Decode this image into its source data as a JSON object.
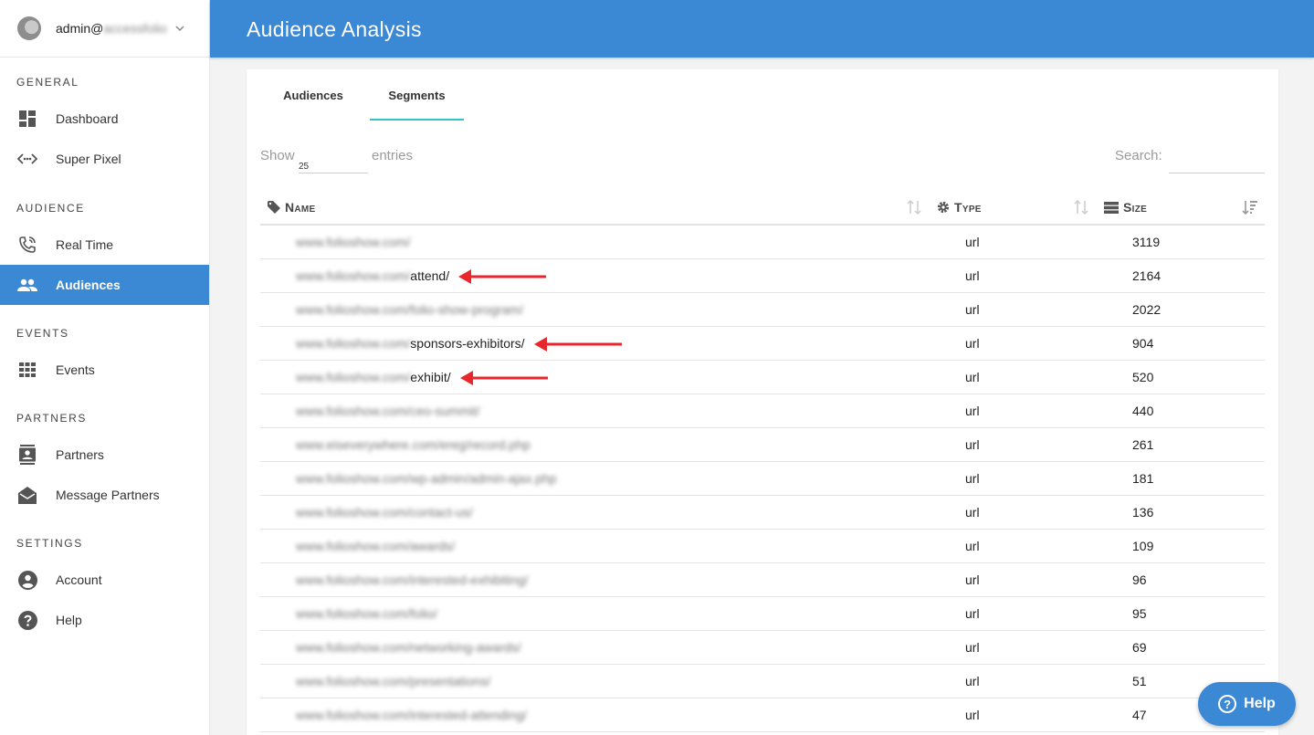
{
  "user": {
    "name_prefix": "admin@",
    "name_blurred": "accessfolio"
  },
  "sidebar": {
    "sections": [
      {
        "title": "GENERAL",
        "items": [
          {
            "label": "Dashboard",
            "icon": "dashboard-icon"
          },
          {
            "label": "Super Pixel",
            "icon": "code-dots-icon"
          }
        ]
      },
      {
        "title": "AUDIENCE",
        "items": [
          {
            "label": "Real Time",
            "icon": "phone-icon"
          },
          {
            "label": "Audiences",
            "icon": "people-icon",
            "active": true
          }
        ]
      },
      {
        "title": "EVENTS",
        "items": [
          {
            "label": "Events",
            "icon": "grid-icon"
          }
        ]
      },
      {
        "title": "PARTNERS",
        "items": [
          {
            "label": "Partners",
            "icon": "contacts-icon"
          },
          {
            "label": "Message Partners",
            "icon": "drafts-icon"
          }
        ]
      },
      {
        "title": "SETTINGS",
        "items": [
          {
            "label": "Account",
            "icon": "account-circle-icon"
          },
          {
            "label": "Help",
            "icon": "help-circle-icon"
          }
        ]
      }
    ]
  },
  "header": {
    "title": "Audience Analysis"
  },
  "tabs": [
    {
      "label": "Audiences"
    },
    {
      "label": "Segments",
      "active": true
    }
  ],
  "controls": {
    "show_label": "Show",
    "page_size": "25",
    "entries_label": "entries",
    "search_label": "Search:"
  },
  "table": {
    "columns": [
      {
        "label": "Name",
        "icon": "tag-icon"
      },
      {
        "label": "Type",
        "icon": "cog-icon"
      },
      {
        "label": "Size",
        "icon": "server-icon"
      }
    ],
    "rows": [
      {
        "base": "www.folioshow.com/",
        "path": "",
        "type": "url",
        "size": "3119"
      },
      {
        "base": "www.folioshow.com/",
        "path": "attend/",
        "type": "url",
        "size": "2164",
        "arrow": true
      },
      {
        "base": "www.folioshow.com/folio-show-program/",
        "path": "",
        "type": "url",
        "size": "2022"
      },
      {
        "base": "www.folioshow.com/",
        "path": "sponsors-exhibitors/",
        "type": "url",
        "size": "904",
        "arrow": true
      },
      {
        "base": "www.folioshow.com/",
        "path": "exhibit/",
        "type": "url",
        "size": "520",
        "arrow": true
      },
      {
        "base": "www.folioshow.com/ceo-summit/",
        "path": "",
        "type": "url",
        "size": "440"
      },
      {
        "base": "www.eiseverywhere.com/ereg/record.php",
        "path": "",
        "type": "url",
        "size": "261"
      },
      {
        "base": "www.folioshow.com/wp-admin/admin-ajax.php",
        "path": "",
        "type": "url",
        "size": "181"
      },
      {
        "base": "www.folioshow.com/contact-us/",
        "path": "",
        "type": "url",
        "size": "136"
      },
      {
        "base": "www.folioshow.com/awards/",
        "path": "",
        "type": "url",
        "size": "109"
      },
      {
        "base": "www.folioshow.com/interested-exhibiting/",
        "path": "",
        "type": "url",
        "size": "96"
      },
      {
        "base": "www.folioshow.com/folio/",
        "path": "",
        "type": "url",
        "size": "95"
      },
      {
        "base": "www.folioshow.com/networking-awards/",
        "path": "",
        "type": "url",
        "size": "69"
      },
      {
        "base": "www.folioshow.com/presentations/",
        "path": "",
        "type": "url",
        "size": "51"
      },
      {
        "base": "www.folioshow.com/interested-attending/",
        "path": "",
        "type": "url",
        "size": "47"
      }
    ]
  },
  "help_button": {
    "label": "Help"
  },
  "colors": {
    "primary": "#3b88d4",
    "tab_underline": "#33c3c9",
    "annotation_arrow": "#e8262b"
  }
}
